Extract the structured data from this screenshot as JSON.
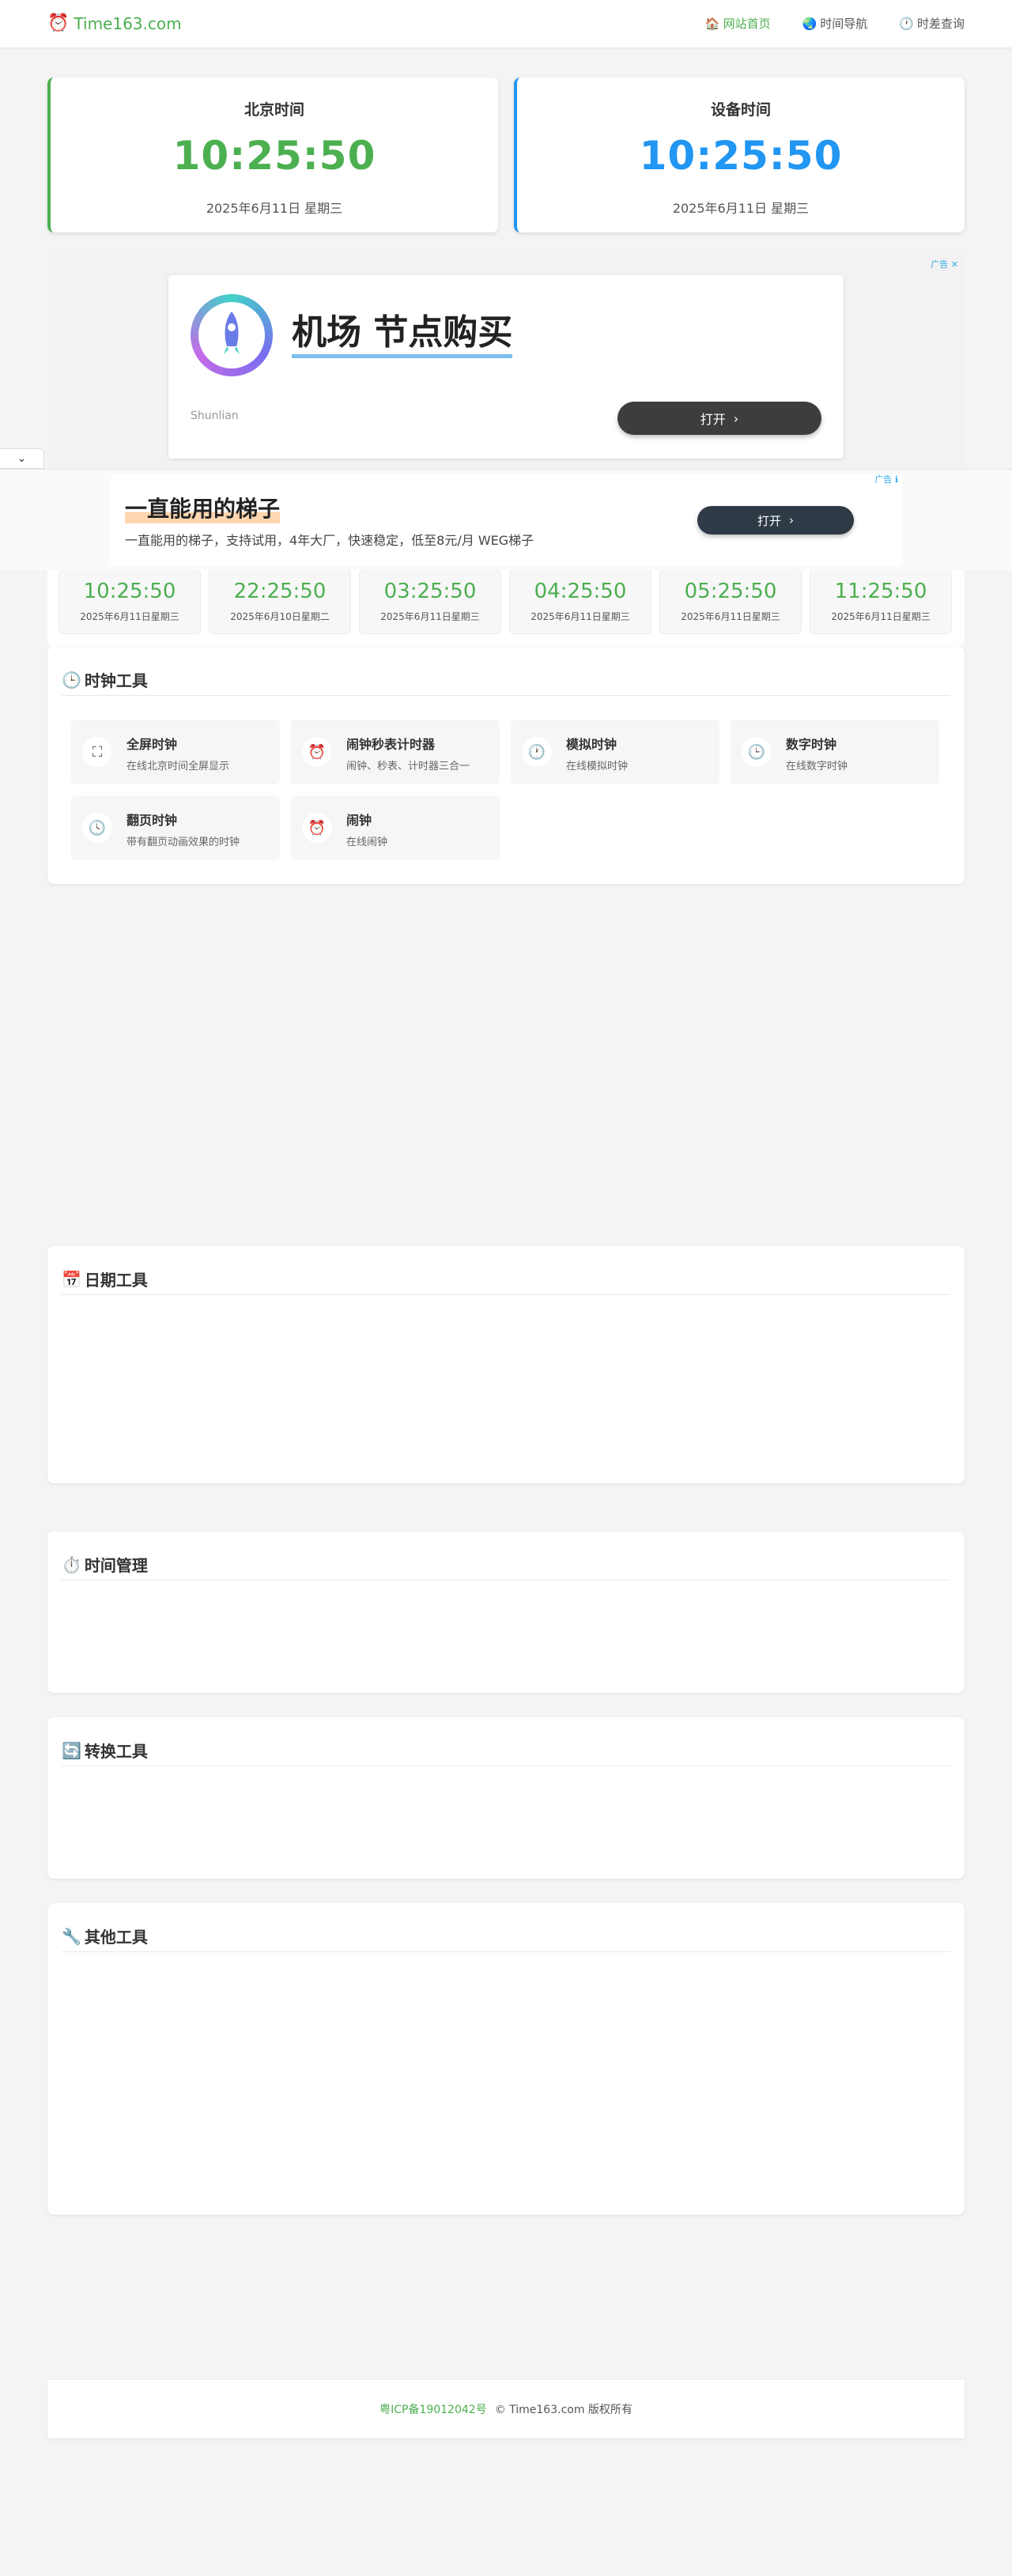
{
  "header": {
    "logo_icon": "⏰",
    "logo_text": "Time163.com",
    "nav": [
      {
        "icon": "🏠",
        "label": "网站首页"
      },
      {
        "icon": "🌏",
        "label": "时间导航"
      },
      {
        "icon": "🕐",
        "label": "时差查询"
      }
    ]
  },
  "beijing": {
    "label": "北京时间",
    "time": "10:25:50",
    "date": "2025年6月11日 星期三"
  },
  "device": {
    "label": "设备时间",
    "time": "10:25:50",
    "date": "2025年6月11日 星期三"
  },
  "ad1": {
    "tag": "广告 ✕",
    "title": "机场 节点购买",
    "brand": "Shunlian",
    "button": "打开",
    "arrow": "›"
  },
  "collapse": {
    "icon": "⌄"
  },
  "ad2": {
    "tag": "广告 ℹ",
    "title": "一直能用的梯子",
    "desc": "一直能用的梯子，支持试用，4年大厂，快速稳定，低至8元/月 WEG梯子",
    "button": "打开",
    "arrow": "›"
  },
  "world_clocks": [
    {
      "time": "10:25:50",
      "date": "2025年6月11日星期三"
    },
    {
      "time": "22:25:50",
      "date": "2025年6月10日星期二"
    },
    {
      "time": "03:25:50",
      "date": "2025年6月11日星期三"
    },
    {
      "time": "04:25:50",
      "date": "2025年6月11日星期三"
    },
    {
      "time": "05:25:50",
      "date": "2025年6月11日星期三"
    },
    {
      "time": "11:25:50",
      "date": "2025年6月11日星期三"
    }
  ],
  "sections": {
    "clock": {
      "icon": "🕒",
      "title": "时钟工具"
    },
    "date": {
      "icon": "📅",
      "title": "日期工具"
    },
    "time": {
      "icon": "⏱️",
      "title": "时间管理"
    },
    "convert": {
      "icon": "🔄",
      "title": "转换工具"
    },
    "other": {
      "icon": "🔧",
      "title": "其他工具"
    }
  },
  "clock_tools": [
    {
      "icon": "⛶",
      "name": "全屏时钟",
      "desc": "在线北京时间全屏显示"
    },
    {
      "icon": "⏰",
      "name": "闹钟秒表计时器",
      "desc": "闹钟、秒表、计时器三合一"
    },
    {
      "icon": "🕐",
      "name": "模拟时钟",
      "desc": "在线模拟时钟"
    },
    {
      "icon": "🕒",
      "name": "数字时钟",
      "desc": "在线数字时钟"
    },
    {
      "icon": "🕓",
      "name": "翻页时钟",
      "desc": "带有翻页动画效果的时钟"
    },
    {
      "icon": "⏰",
      "name": "闹钟",
      "desc": "在线闹钟"
    }
  ],
  "footer": {
    "icp": "粤ICP备19012042号",
    "copyright": "© Time163.com 版权所有"
  }
}
